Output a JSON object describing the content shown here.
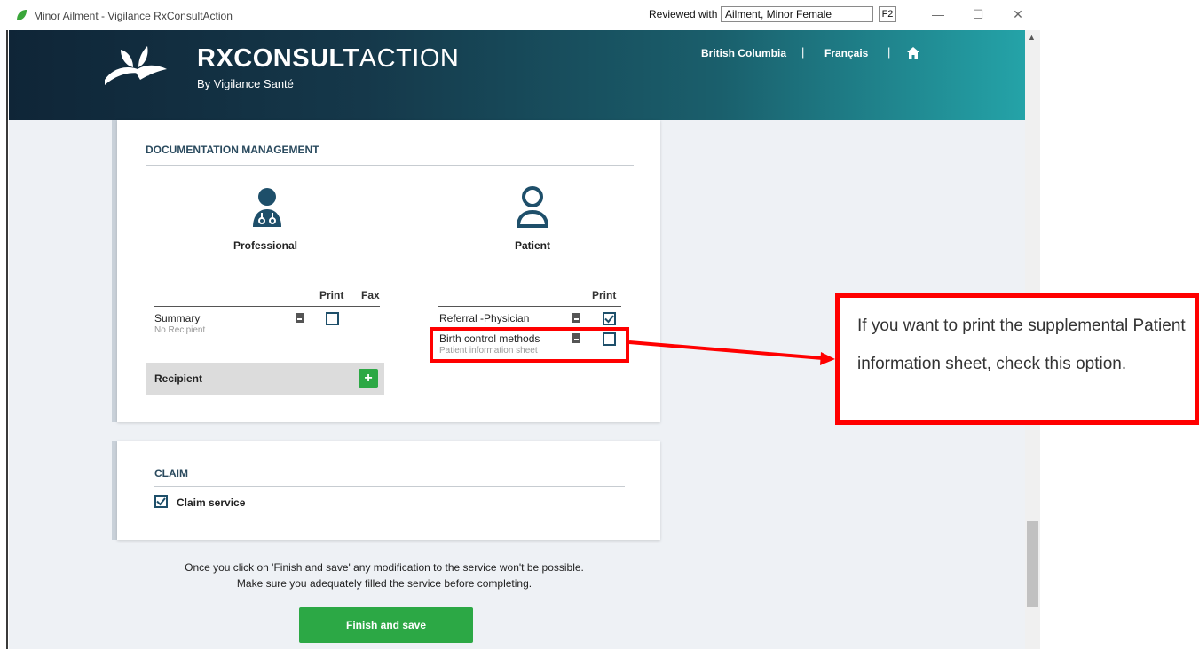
{
  "window": {
    "title": "Minor Ailment - Vigilance RxConsultAction",
    "reviewed_label": "Reviewed with",
    "reviewed_value": "Ailment, Minor Female",
    "shortcut": "F2",
    "minimize": "—",
    "maximize": "☐",
    "close": "✕"
  },
  "header": {
    "brand_bold": "RXCONSULT",
    "brand_light": "ACTION",
    "brand_sub": "By Vigilance Santé",
    "nav": {
      "province": "British Columbia",
      "separator": "|",
      "language": "Français"
    }
  },
  "documentation": {
    "title": "DOCUMENTATION MANAGEMENT",
    "professional": {
      "label": "Professional",
      "col_print": "Print",
      "col_fax": "Fax",
      "rows": [
        {
          "name": "Summary",
          "sub": "No Recipient",
          "print": false
        }
      ],
      "recipient_label": "Recipient",
      "add_symbol": "+"
    },
    "patient": {
      "label": "Patient",
      "col_print": "Print",
      "rows": [
        {
          "name": "Referral -Physician",
          "sub": "",
          "print": true
        },
        {
          "name": "Birth control methods",
          "sub": "Patient information sheet",
          "print": false
        }
      ]
    }
  },
  "claim": {
    "title": "CLAIM",
    "checkbox_label": "Claim service",
    "checked": true
  },
  "footer": {
    "note_line1": "Once you click on 'Finish and save' any modification to the service won't be possible.",
    "note_line2": "Make sure you adequately filled the service before completing.",
    "finish_label": "Finish and save"
  },
  "annotation": {
    "text": "If you want to print the supplemental Patient information sheet, check this option.",
    "color": "#ff0000"
  },
  "colors": {
    "accent_green": "#2ca845",
    "title_navy": "#2a4a5e",
    "icon_teal": "#1e4f6a"
  }
}
